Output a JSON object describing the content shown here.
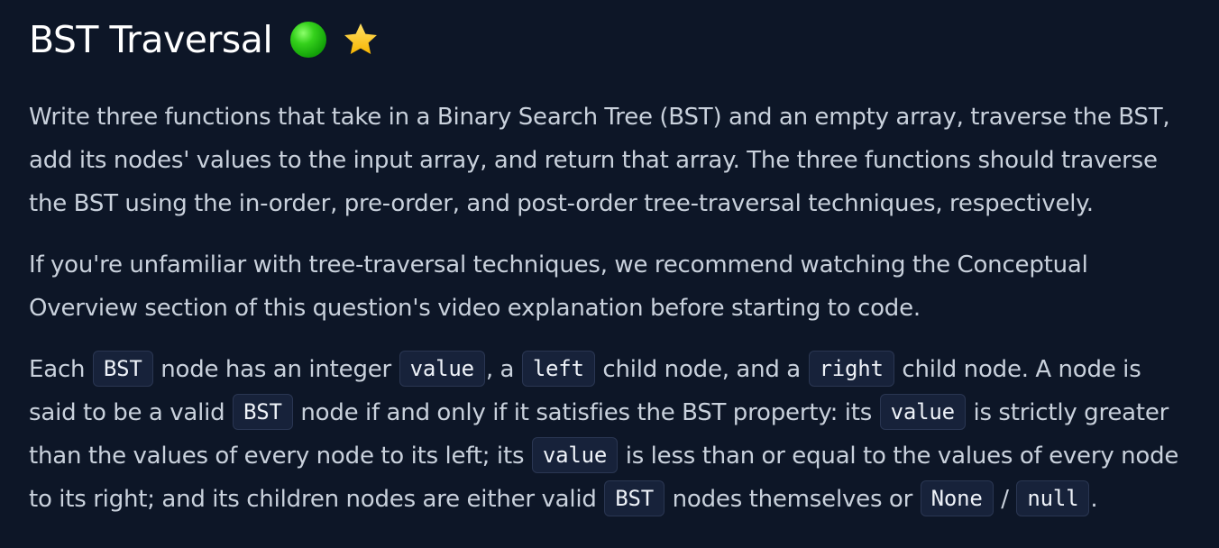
{
  "header": {
    "title": "BST Traversal",
    "difficulty_color": "#22c30f",
    "star_color": "#ffcf2e"
  },
  "content": {
    "paragraph1": "Write three functions that take in a Binary Search Tree (BST) and an empty array, traverse the BST, add its nodes' values to the input array, and return that array. The three functions should traverse the BST using the in-order, pre-order, and post-order tree-traversal techniques, respectively.",
    "paragraph2": "If you're unfamiliar with tree-traversal techniques, we recommend watching the Conceptual Overview section of this question's video explanation before starting to code.",
    "paragraph3": {
      "t1": "Each ",
      "c1": "BST",
      "t2": " node has an integer ",
      "c2": "value",
      "t3": ", a ",
      "c3": "left",
      "t4": " child node, and a ",
      "c4": "right",
      "t5": " child node. A node is said to be a valid ",
      "c5": "BST",
      "t6": " node if and only if it satisfies the BST property: its ",
      "c6": "value",
      "t7": " is strictly greater than the values of every node to its left; its ",
      "c7": "value",
      "t8": " is less than or equal to the values of every node to its right; and its children nodes are either valid ",
      "c8": "BST",
      "t9": " nodes themselves or ",
      "c9": "None",
      "t10": " / ",
      "c10": "null",
      "t11": "."
    }
  }
}
